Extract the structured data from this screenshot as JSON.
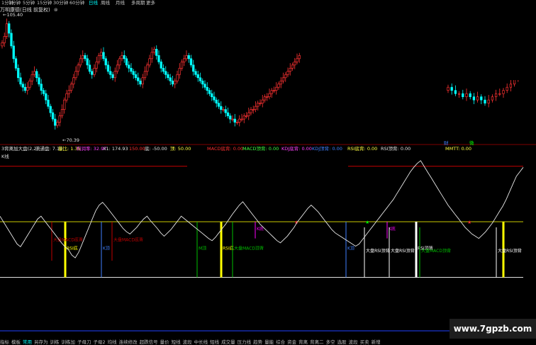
{
  "tabs": [
    {
      "label": "1分钟"
    },
    {
      "label": "1分钟"
    },
    {
      "label": "5分钟"
    },
    {
      "label": "15分钟"
    },
    {
      "label": "30分钟"
    },
    {
      "label": "60分钟"
    },
    {
      "label": "日线",
      "active": true
    },
    {
      "label": "周线"
    },
    {
      "label": "月线"
    },
    {
      "label": "多周期"
    },
    {
      "label": "更多"
    }
  ],
  "title_bar": {
    "text": "万明康德(日线 前复权)",
    "close_glyph": "⊗"
  },
  "indicator_header": {
    "items": [
      {
        "text": "3背离加大盘(2,2)",
        "color": "#e0e0e0"
      },
      {
        "text": "流通盘: 7.19",
        "color": "#e0e0e0"
      },
      {
        "text": "量比: 1.35",
        "color": "#ffff40"
      },
      {
        "text": "利润率: 32.97",
        "color": "#ff40ff"
      },
      {
        "text": "X1: 174.93",
        "color": "#e0e0e0"
      },
      {
        "text": "150.00",
        "color": "#ff3030"
      },
      {
        "text": "底: -50.00",
        "color": "#e0e0e0"
      },
      {
        "text": "顶: 50.00",
        "color": "#ffff40"
      },
      {
        "text": "MACD底背: 0.00",
        "color": "#ff3030"
      },
      {
        "text": "MACD顶背: 0.00",
        "color": "#40ff40"
      },
      {
        "text": "KDJ底背: 0.00",
        "color": "#ff40ff"
      },
      {
        "text": "KDJ顶背: 0.00",
        "color": "#4080ff"
      },
      {
        "text": "RSI底背: 0.00",
        "color": "#ffff40"
      },
      {
        "text": "RSI顶背: 0.00",
        "color": "#e0e0e0"
      },
      {
        "text": "MMTT: 0.00",
        "color": "#ffff40"
      }
    ],
    "sub": "K线"
  },
  "price_labels": {
    "high": "105.40",
    "low": "70.39"
  },
  "markers": {
    "cai": "财",
    "wei": "微"
  },
  "bottom_menu": [
    "指标",
    "模板",
    "常用",
    "另存为",
    "训练",
    "训练加",
    "子母刀",
    "子母2",
    "均线",
    "连续修改",
    "超跌信号",
    "量价",
    "短线",
    "波段",
    "中长线",
    "短线",
    "成交量",
    "压力线",
    "趋势",
    "量能",
    "综合",
    "资金",
    "背离",
    "背离二",
    "多空",
    "选股",
    "波段",
    "买卖",
    "新增"
  ],
  "watermark": {
    "text": "www.7gpzb.com"
  },
  "colors": {
    "up": "#ff3232",
    "down": "#00ffff",
    "line": "#e8e8e8",
    "redline": "#c00000",
    "yellow": "#ffff00",
    "green": "#00ff00",
    "magenta": "#ff00ff",
    "blue": "#4080ff"
  },
  "chart_data": [
    {
      "type": "candlestick",
      "title": "万明康德(日线 前复权)",
      "ylim": [
        68,
        107
      ],
      "annotations": [
        {
          "text": "105.40",
          "kind": "high"
        },
        {
          "text": "70.39",
          "kind": "low"
        }
      ],
      "close": [
        98,
        100,
        104,
        101,
        97,
        93,
        90,
        87,
        85,
        84,
        83,
        84,
        86,
        88,
        89,
        87,
        85,
        83,
        82,
        80,
        78,
        76,
        74,
        72,
        73,
        75,
        77,
        80,
        82,
        83,
        85,
        87,
        89,
        91,
        93,
        94,
        93,
        91,
        89,
        88,
        90,
        92,
        94,
        95,
        93,
        91,
        89,
        88,
        87,
        89,
        91,
        93,
        94,
        93,
        91,
        90,
        89,
        88,
        87,
        86,
        85,
        87,
        89,
        91,
        93,
        95,
        96,
        94,
        92,
        90,
        89,
        88,
        87,
        86,
        85,
        86,
        88,
        90,
        92,
        93,
        94,
        93,
        91,
        89,
        88,
        87,
        86,
        85,
        84,
        83,
        82,
        81,
        80,
        79,
        78,
        77,
        77,
        76,
        75,
        74,
        74,
        73,
        73,
        74,
        74,
        75,
        75,
        76,
        77,
        77,
        78,
        79,
        79,
        80,
        81,
        81,
        82,
        83,
        83,
        84,
        85,
        86,
        87,
        88,
        89,
        90,
        91,
        92,
        93,
        94
      ],
      "note": "segment left of blacked-out region; right segment continues",
      "close_right": [
        84,
        83,
        82,
        82,
        81,
        82,
        81,
        80,
        81,
        80,
        79,
        80,
        81,
        82,
        82,
        83,
        84,
        85,
        87,
        89
      ]
    },
    {
      "type": "line",
      "title": "3背离加大盘(2,2)",
      "ylim": [
        -80,
        175
      ],
      "reference_lines": [
        {
          "value": 150,
          "color": "red"
        },
        {
          "value": 50,
          "color": "yellow"
        },
        {
          "value": -50,
          "color": "white"
        }
      ],
      "values": [
        60,
        50,
        40,
        30,
        20,
        10,
        5,
        15,
        25,
        35,
        45,
        55,
        60,
        52,
        44,
        36,
        28,
        20,
        12,
        5,
        0,
        -10,
        -15,
        -5,
        10,
        25,
        40,
        55,
        70,
        80,
        85,
        78,
        70,
        62,
        54,
        46,
        38,
        32,
        28,
        34,
        40,
        48,
        55,
        60,
        52,
        45,
        38,
        30,
        24,
        30,
        36,
        44,
        52,
        60,
        55,
        50,
        45,
        40,
        35,
        30,
        25,
        20,
        16,
        22,
        30,
        38,
        46,
        55,
        64,
        72,
        80,
        86,
        78,
        70,
        62,
        54,
        46,
        40,
        34,
        28,
        22,
        16,
        12,
        18,
        24,
        32,
        40,
        50,
        58,
        66,
        74,
        80,
        74,
        68,
        60,
        52,
        44,
        36,
        30,
        26,
        22,
        18,
        14,
        10,
        6,
        10,
        18,
        26,
        34,
        42,
        50,
        58,
        66,
        74,
        82,
        90,
        100,
        110,
        120,
        130,
        140,
        148,
        155,
        160,
        150,
        140,
        130,
        120,
        110,
        100,
        90,
        80,
        72,
        64,
        56,
        48,
        40,
        34,
        28,
        24,
        20,
        26,
        32,
        40,
        48,
        58,
        68,
        78,
        90,
        104,
        118,
        132,
        140,
        148
      ]
    }
  ]
}
